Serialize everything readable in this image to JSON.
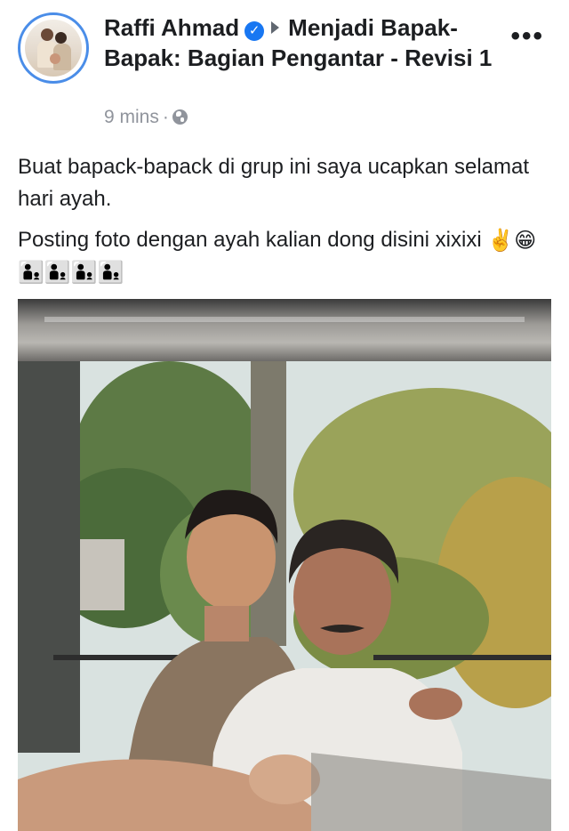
{
  "post": {
    "author": "Raffi Ahmad",
    "group": "Menjadi Bapak-Bapak: Bagian Pengantar - Revisi 1",
    "time": "9 mins",
    "separator": "·",
    "privacy_icon": "globe-icon",
    "more_icon": "more-options-icon",
    "more_label": "•••",
    "paragraphs": [
      "Buat bapack-bapack di grup ini saya ucapkan selamat hari ayah.",
      "Posting foto dengan ayah kalian dong disini xixixi"
    ],
    "emojis": [
      "✌️",
      "😁",
      "👨‍👦",
      "👨‍👦",
      "👨‍👦",
      "👨‍👦"
    ],
    "verified_mark": "✓"
  },
  "colors": {
    "text": "#1c1e21",
    "meta": "#90949c",
    "verified": "#1877f2",
    "avatar_ring": "#4a8de8"
  }
}
